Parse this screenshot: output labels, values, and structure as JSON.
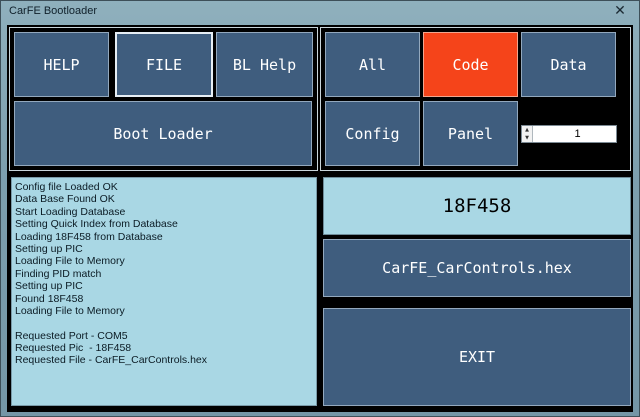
{
  "window": {
    "title": "CarFE Bootloader",
    "close_glyph": "✕"
  },
  "menu": {
    "help_label": "HELP",
    "file_label": "FILE",
    "bl_help_label": "BL Help",
    "boot_loader_label": "Boot Loader"
  },
  "filters": {
    "all_label": "All",
    "code_label": "Code",
    "data_label": "Data",
    "config_label": "Config",
    "panel_label": "Panel",
    "active": "Code",
    "active_color": "#f5441a"
  },
  "spinner": {
    "value": "1",
    "up_glyph": "▲",
    "down_glyph": "▼"
  },
  "log": {
    "lines": [
      "Config file Loaded OK",
      "Data Base Found OK",
      "Start Loading Database",
      "Setting Quick Index from Database",
      "Loading 18F458 from Database",
      "Setting up PIC",
      "Loading File to Memory",
      "Finding PID match",
      "Setting up PIC",
      "Found 18F458",
      "Loading File to Memory",
      "",
      "Requested Port - COM5",
      "Requested Pic  - 18F458",
      "Requested File - CarFE_CarControls.hex"
    ]
  },
  "device": {
    "pic_model": "18F458"
  },
  "file": {
    "name": "CarFE_CarControls.hex"
  },
  "actions": {
    "exit_label": "EXIT"
  },
  "colors": {
    "button_bg": "#3f5d7e",
    "log_bg": "#a9d7e4",
    "device_box_bg": "#a9d7e4"
  }
}
